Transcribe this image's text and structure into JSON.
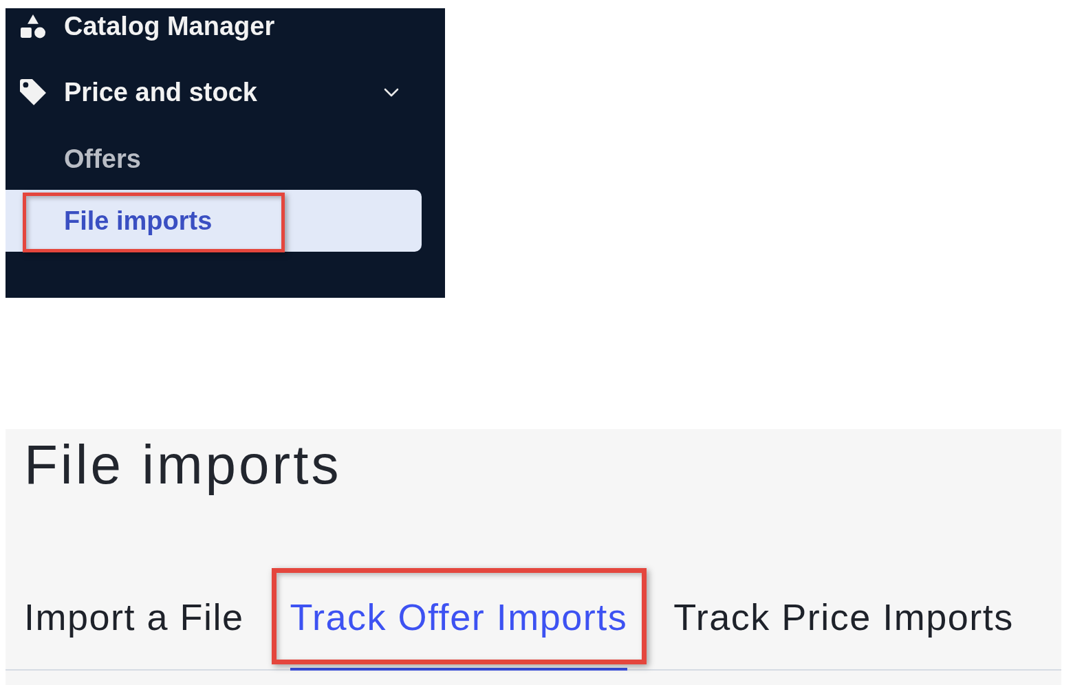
{
  "sidebar": {
    "items": [
      {
        "label": "Catalog Manager",
        "kind": "link"
      },
      {
        "label": "Price and stock",
        "kind": "group",
        "expanded": true,
        "children": [
          {
            "label": "Offers",
            "selected": false,
            "highlighted": false
          },
          {
            "label": "File imports",
            "selected": true,
            "highlighted": true
          }
        ]
      }
    ]
  },
  "page": {
    "title": "File imports",
    "tabs": [
      {
        "label": "Import a File",
        "selected": false,
        "highlighted": false
      },
      {
        "label": "Track Offer Imports",
        "selected": true,
        "highlighted": true
      },
      {
        "label": "Track Price Imports",
        "selected": false,
        "highlighted": false
      }
    ]
  }
}
